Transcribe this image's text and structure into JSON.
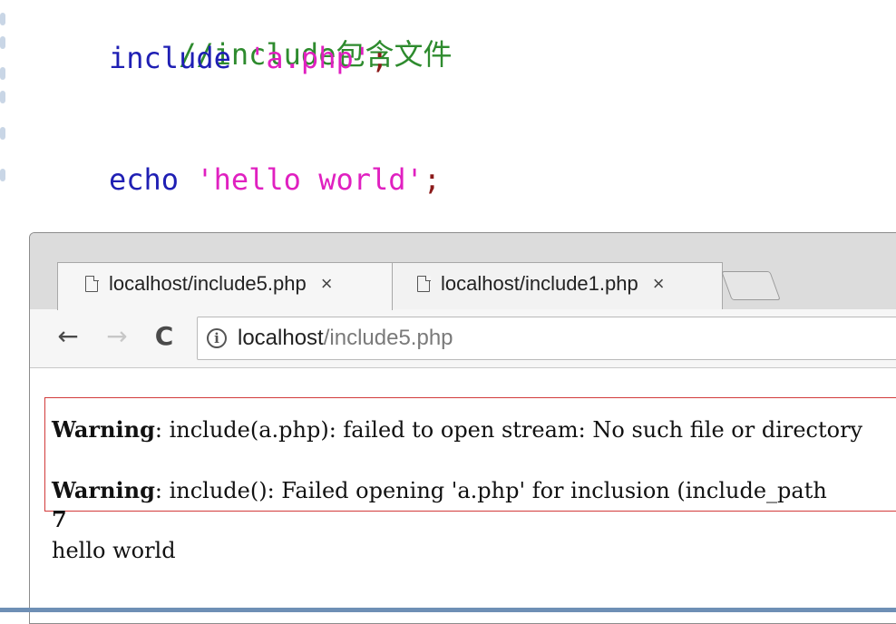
{
  "editor": {
    "line1": {
      "comment": "//include包含文件"
    },
    "line2": {
      "keyword": "include",
      "space": " ",
      "string": "'a.php'",
      "end": ";"
    },
    "line3": {
      "keyword": "echo",
      "space": " ",
      "string": "'hello world'",
      "end": ";"
    }
  },
  "browser": {
    "tabs": [
      {
        "title": "localhost/include5.php",
        "close": "×"
      },
      {
        "title": "localhost/include1.php",
        "close": "×"
      }
    ],
    "nav": {
      "back": "←",
      "forward": "→",
      "reload": "C"
    },
    "address": {
      "info": "i",
      "host": "localhost",
      "path": "/include5.php"
    }
  },
  "output": {
    "warnings": [
      {
        "label": "Warning",
        "text": ": include(a.php): failed to open stream: No such file or directory"
      },
      {
        "label": "Warning",
        "text": ": include(): Failed opening 'a.php' for inclusion (include_path"
      }
    ],
    "number": "7",
    "echo": "hello world"
  }
}
